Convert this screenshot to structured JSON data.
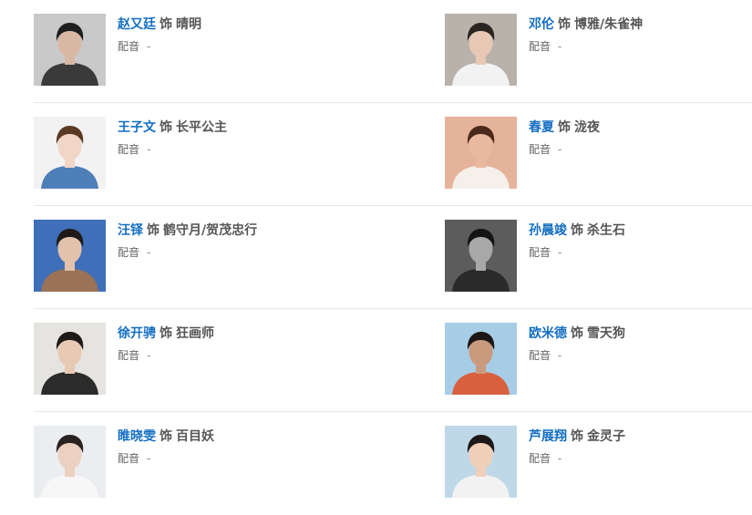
{
  "cast": [
    {
      "actor": "赵又廷",
      "role_sep": "饰",
      "role": "晴明",
      "va_label": "配音",
      "va_value": "-",
      "photo": {
        "bg": "#c9c9c9",
        "hair": "#1f1f1f",
        "skin": "#d8b8a4",
        "shirt": "#3a3a3a"
      }
    },
    {
      "actor": "邓伦",
      "role_sep": "饰",
      "role": "博雅/朱雀神",
      "va_label": "配音",
      "va_value": "-",
      "photo": {
        "bg": "#b9b2ab",
        "hair": "#2a2523",
        "skin": "#e6c8b4",
        "shirt": "#f2f2f2"
      }
    },
    {
      "actor": "王子文",
      "role_sep": "饰",
      "role": "长平公主",
      "va_label": "配音",
      "va_value": "-",
      "photo": {
        "bg": "#f2f2f2",
        "hair": "#5a3a24",
        "skin": "#f1d6c8",
        "shirt": "#4f7fb8"
      }
    },
    {
      "actor": "春夏",
      "role_sep": "饰",
      "role": "泷夜",
      "va_label": "配音",
      "va_value": "-",
      "photo": {
        "bg": "#e5b39a",
        "hair": "#4a2a1c",
        "skin": "#e9b89e",
        "shirt": "#f5f0ea"
      }
    },
    {
      "actor": "汪铎",
      "role_sep": "饰",
      "role": "鹤守月/贺茂忠行",
      "va_label": "配音",
      "va_value": "-",
      "photo": {
        "bg": "#3f6fb8",
        "hair": "#1f1a18",
        "skin": "#e3c2ac",
        "shirt": "#9a7256"
      }
    },
    {
      "actor": "孙晨竣",
      "role_sep": "饰",
      "role": "杀生石",
      "va_label": "配音",
      "va_value": "-",
      "photo": {
        "bg": "#5c5c5c",
        "hair": "#141414",
        "skin": "#a8a8a8",
        "shirt": "#2a2a2a"
      }
    },
    {
      "actor": "徐开骋",
      "role_sep": "饰",
      "role": "狂画师",
      "va_label": "配音",
      "va_value": "-",
      "photo": {
        "bg": "#e6e4e1",
        "hair": "#1e1a18",
        "skin": "#e7c9b4",
        "shirt": "#2b2b2b"
      }
    },
    {
      "actor": "欧米德",
      "role_sep": "饰",
      "role": "雪天狗",
      "va_label": "配音",
      "va_value": "-",
      "photo": {
        "bg": "#a7cde6",
        "hair": "#1c1715",
        "skin": "#c99a7e",
        "shirt": "#d8603e"
      }
    },
    {
      "actor": "睢晓雯",
      "role_sep": "饰",
      "role": "百目妖",
      "va_label": "配音",
      "va_value": "-",
      "photo": {
        "bg": "#ecedf0",
        "hair": "#2a2220",
        "skin": "#ecd0c0",
        "shirt": "#f7f7f7"
      }
    },
    {
      "actor": "芦展翔",
      "role_sep": "饰",
      "role": "金灵子",
      "va_label": "配音",
      "va_value": "-",
      "photo": {
        "bg": "#bfd8e8",
        "hair": "#1e1816",
        "skin": "#f0cfb8",
        "shirt": "#f2f2f2"
      }
    }
  ]
}
